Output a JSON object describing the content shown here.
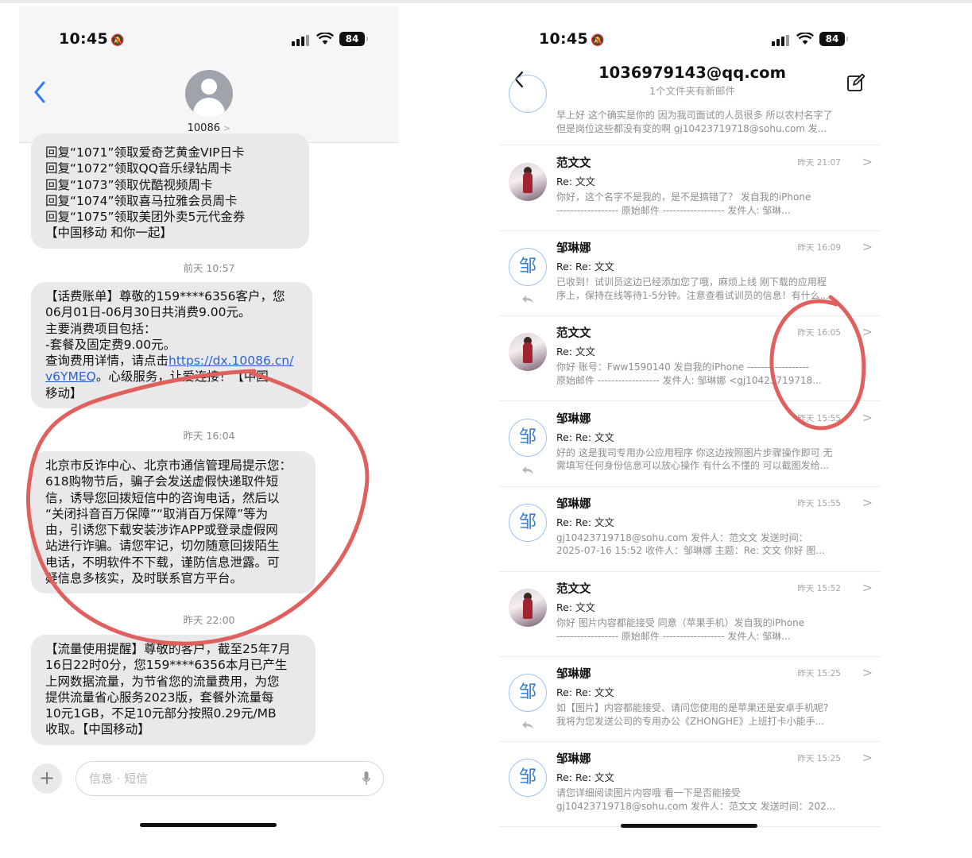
{
  "sms": {
    "status": {
      "time": "10:45",
      "battery": "84"
    },
    "contact": "10086",
    "contact_chevron": ">",
    "bubbles": [
      {
        "lines": [
          "回复“1071”领取爱奇艺黄金VIP日卡",
          "回复“1072”领取QQ音乐绿钻周卡",
          "回复“1073”领取优酷视频周卡",
          "回复“1074”领取喜马拉雅会员周卡",
          "回复“1075”领取美团外卖5元代金券",
          "【中国移动 和你一起】"
        ]
      },
      {
        "timestamp": "前天 10:57",
        "lines": [
          "【话费账单】尊敬的159****6356客户，您",
          "06月01日-06月30日共消费9.00元。",
          "主要消费项目包括：",
          "-套餐及固定费9.00元。"
        ],
        "link_prefix": "查询费用详情，请点击",
        "link_a": "https://dx.10086.cn/",
        "link_b": "v6YMEQ",
        "link_suffix": "。心级服务，让爱连接！【中国",
        "tail": "移动】"
      },
      {
        "timestamp": "昨天 16:04",
        "lines": [
          "北京市反诈中心、北京市通信管理局提示您：",
          "618购物节后，骗子会发送虚假快递取件短",
          "信，诱导您回拨短信中的咨询电话，然后以",
          "“关闭抖音百万保障”“取消百万保障”等为",
          "由，引诱您下载安装涉诈APP或登录虚假网",
          "站进行诈骗。请您牢记，切勿随意回拨陌生",
          "电话，不明软件不下载，谨防信息泄露。可",
          "疑信息多核实，及时联系官方平台。"
        ]
      },
      {
        "timestamp": "昨天 22:00",
        "lines": [
          "【流量使用提醒】尊敬的客户，截至25年7月",
          "16日22时0分，您159****6356本月已产生",
          "上网数据流量，为节省您的流量费用，为您",
          "提供流量省心服务2023版，套餐外流量每",
          "10元1GB，不足10元部分按照0.29元/MB",
          "收取。【中国移动】"
        ]
      }
    ],
    "input_placeholder": "信息 · 短信",
    "plus_label": "+"
  },
  "mail": {
    "status": {
      "time": "10:45",
      "battery": "84"
    },
    "title": "1036979143@qq.com",
    "subtitle": "1个文件夹有新邮件",
    "partial_preview": [
      "早上好 这个确实是你的 因为我司面试的人员很多 所以农村名字了",
      "但是岗位这些都没有变的啊 gj10423719718@sohu.com 发..."
    ],
    "avatar_char": "邹",
    "chevron": ">",
    "rows": [
      {
        "sender": "范文文",
        "date": "昨天 21:07",
        "subject": "Re: 文文",
        "preview": [
          "你好，这个名字不是我的，是不是搞错了？ 发自我的iPhone",
          "------------------ 原始邮件 ------------------ 发件人: 邹琳..."
        ],
        "avatar": "photo",
        "replied": false
      },
      {
        "sender": "邹琳娜",
        "date": "昨天 16:09",
        "subject": "Re: Re: 文文",
        "preview": [
          "已收到！试训员这边已经添加您了哦，麻烦上线 刚下载的应用程",
          "序上，保持在线等待1-5分钟。注意查看试训员的信息！有什么..."
        ],
        "avatar": "letter",
        "replied": true
      },
      {
        "sender": "范文文",
        "date": "昨天 16:05",
        "subject": "Re: 文文",
        "preview": [
          "你好 账号：Fww1590140 发自我的iPhone ------------------",
          "原始邮件 ------------------ 发件人: 邹琳娜 <gj10423719718..."
        ],
        "avatar": "photo",
        "replied": false
      },
      {
        "sender": "邹琳娜",
        "date": "昨天 15:55",
        "subject": "Re: Re: 文文",
        "preview": [
          "好的 这是我司专用办公应用程序 你这边按照图片步骤操作即可 无",
          "需填写任何身份信息可以放心操作 有什么不懂的 可以截图发给..."
        ],
        "avatar": "letter",
        "replied": true
      },
      {
        "sender": "邹琳娜",
        "date": "昨天 15:55",
        "subject": "Re: Re: 文文",
        "preview": [
          "gj10423719718@sohu.com 发件人：范文文 发送时间：",
          "2025-07-16 15:52 收件人：邹琳娜 主题：Re: 文文 你好 图..."
        ],
        "avatar": "letter",
        "replied": false
      },
      {
        "sender": "范文文",
        "date": "昨天 15:52",
        "subject": "Re: 文文",
        "preview": [
          "你好 图片内容都能接受 同意（苹果手机）发自我的iPhone",
          "------------------ 原始邮件 ------------------ 发件人: 邹琳..."
        ],
        "avatar": "photo",
        "replied": false
      },
      {
        "sender": "邹琳娜",
        "date": "昨天 15:25",
        "subject": "Re: Re: 文文",
        "preview": [
          "如【图片】内容都能接受、请问您使用的是苹果还是安卓手机呢?",
          "我将为您发送公司的专用办公《ZHONGHE》上班打卡小能手..."
        ],
        "avatar": "letter",
        "replied": true
      },
      {
        "sender": "邹琳娜",
        "date": "昨天 15:25",
        "subject": "Re: Re: 文文",
        "preview": [
          "请您详细阅读图片内容哦 看一下是否能接受",
          "gj10423719718@sohu.com 发件人：范文文 发送时间：202..."
        ],
        "avatar": "letter",
        "replied": false
      }
    ]
  },
  "colors": {
    "annotation": "#e0605e",
    "sms_link": "#2a63d1",
    "ios_blue": "#2f7bf6",
    "bubble_bg": "#e9e9eb"
  },
  "icons": [
    "muted-bell-icon",
    "signal-icon",
    "wifi-icon",
    "battery-icon",
    "back-chevron-icon",
    "contact-avatar-icon",
    "plus-icon",
    "microphone-icon",
    "compose-icon",
    "reply-arrow-icon",
    "row-chevron-icon"
  ]
}
